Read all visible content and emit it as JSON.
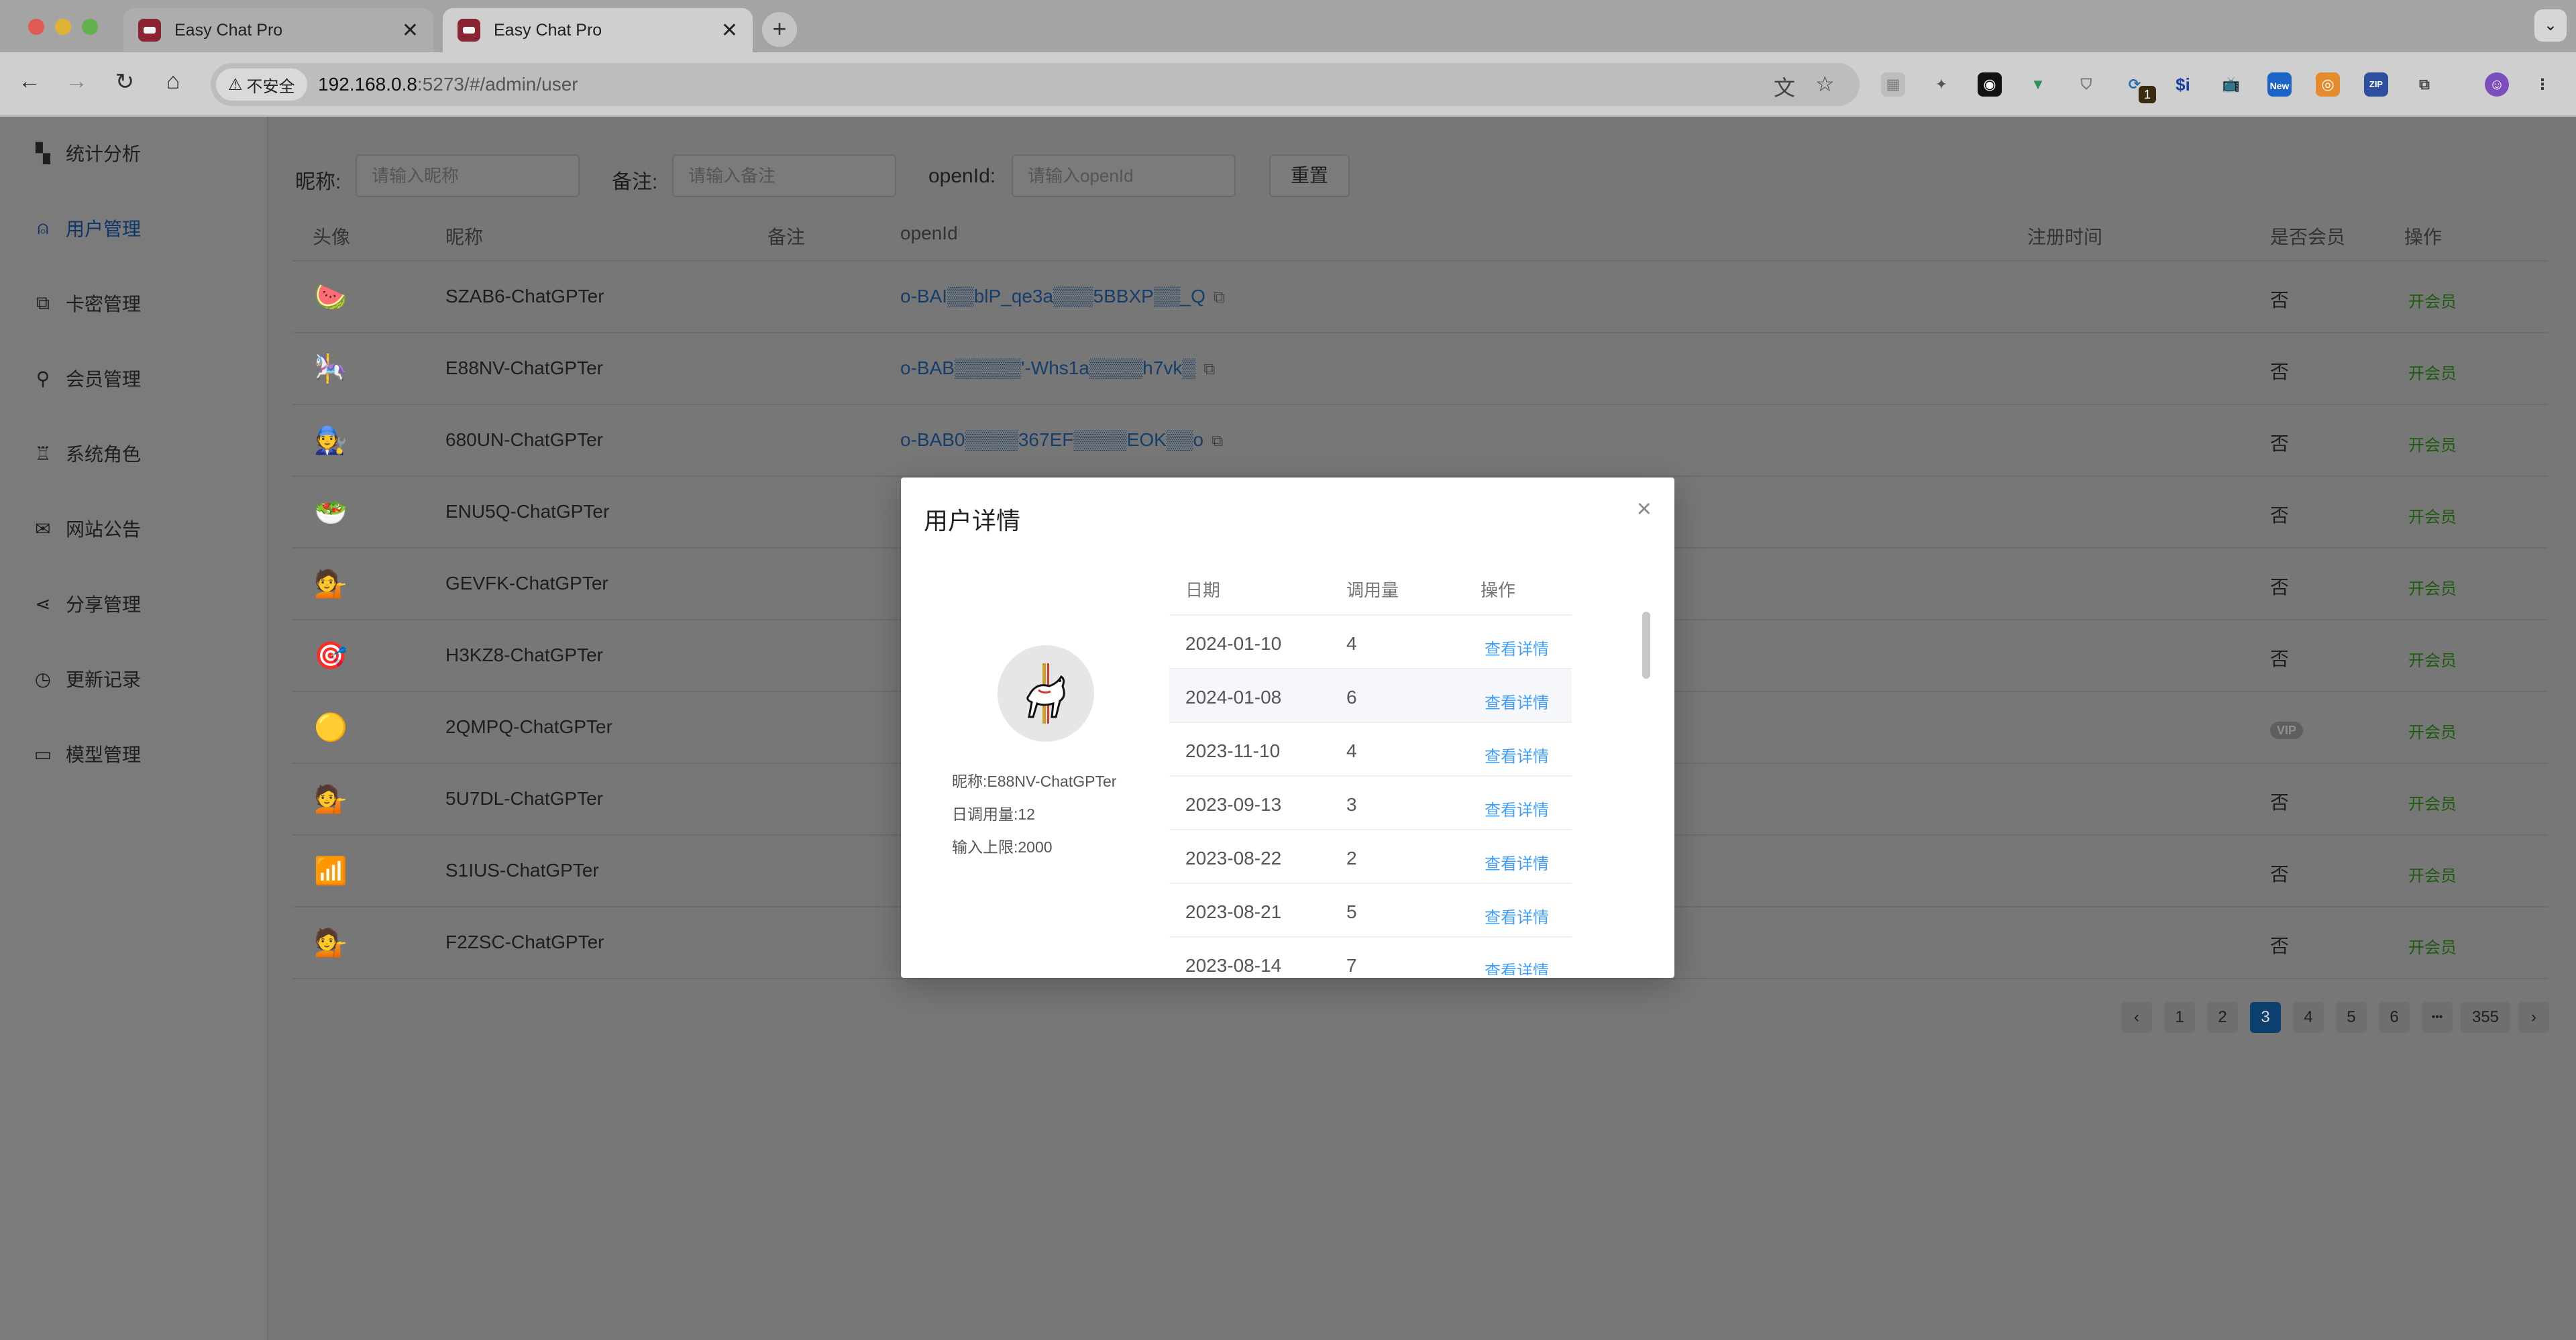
{
  "browser": {
    "tabs": [
      {
        "title": "Easy Chat Pro",
        "active": false
      },
      {
        "title": "Easy Chat Pro",
        "active": true
      }
    ],
    "security_label": "不安全",
    "url_host": "192.168.0.8",
    "url_rest": ":5273/#/admin/user",
    "new_badge": "New",
    "ext_counter": "1",
    "ext_dollar": "$i",
    "ext_zip": "ZIP"
  },
  "sidebar": {
    "items": [
      {
        "label": "统计分析",
        "icon": "dashboard-icon",
        "active": false
      },
      {
        "label": "用户管理",
        "icon": "user-icon",
        "active": true
      },
      {
        "label": "卡密管理",
        "icon": "card-icon",
        "active": false
      },
      {
        "label": "会员管理",
        "icon": "key-icon",
        "active": false
      },
      {
        "label": "系统角色",
        "icon": "role-icon",
        "active": false
      },
      {
        "label": "网站公告",
        "icon": "mail-icon",
        "active": false
      },
      {
        "label": "分享管理",
        "icon": "share-icon",
        "active": false
      },
      {
        "label": "更新记录",
        "icon": "clock-icon",
        "active": false
      },
      {
        "label": "模型管理",
        "icon": "monitor-icon",
        "active": false
      }
    ]
  },
  "filters": {
    "nickname_label": "昵称:",
    "nickname_placeholder": "请输入昵称",
    "remark_label": "备注:",
    "remark_placeholder": "请输入备注",
    "openid_label": "openId:",
    "openid_placeholder": "请输入openId",
    "reset_label": "重置"
  },
  "table": {
    "headers": {
      "avatar": "头像",
      "nickname": "昵称",
      "remark": "备注",
      "openid": "openId",
      "registered": "注册时间",
      "is_member": "是否会员",
      "action": "操作"
    },
    "rows": [
      {
        "avatar": "🍉",
        "nickname": "SZAB6-ChatGPTer",
        "openid": "o-BAI▒▒blP_qe3a▒▒▒5BBXP▒▒_Q",
        "member": "否",
        "vip": false,
        "action": "开会员"
      },
      {
        "avatar": "🎠",
        "nickname": "E88NV-ChatGPTer",
        "openid": "o-BAB▒▒▒▒▒'-Whs1a▒▒▒▒h7vk▒",
        "member": "否",
        "vip": false,
        "action": "开会员"
      },
      {
        "avatar": "🧑‍🔧",
        "nickname": "680UN-ChatGPTer",
        "openid": "o-BAB0▒▒▒▒367EF▒▒▒▒EOK▒▒o",
        "member": "否",
        "vip": false,
        "action": "开会员"
      },
      {
        "avatar": "🥗",
        "nickname": "ENU5Q-ChatGPTer",
        "openid": "",
        "member": "否",
        "vip": false,
        "action": "开会员"
      },
      {
        "avatar": "💁",
        "nickname": "GEVFK-ChatGPTer",
        "openid": "",
        "member": "否",
        "vip": false,
        "action": "开会员"
      },
      {
        "avatar": "🎯",
        "nickname": "H3KZ8-ChatGPTer",
        "openid": "",
        "member": "否",
        "vip": false,
        "action": "开会员"
      },
      {
        "avatar": "🟡",
        "nickname": "2QMPQ-ChatGPTer",
        "openid": "",
        "member": "VIP",
        "vip": true,
        "action": "开会员"
      },
      {
        "avatar": "💁",
        "nickname": "5U7DL-ChatGPTer",
        "openid": "",
        "member": "否",
        "vip": false,
        "action": "开会员"
      },
      {
        "avatar": "📶",
        "nickname": "S1IUS-ChatGPTer",
        "openid": "",
        "member": "否",
        "vip": false,
        "action": "开会员"
      },
      {
        "avatar": "💁",
        "nickname": "F2ZSC-ChatGPTer",
        "openid": "",
        "member": "否",
        "vip": false,
        "action": "开会员"
      }
    ]
  },
  "pagination": {
    "prev": "‹",
    "pages": [
      "1",
      "2",
      "3",
      "4",
      "5",
      "6"
    ],
    "ellipsis": "•••",
    "last": "355",
    "next": "›",
    "current": "3"
  },
  "modal": {
    "title": "用户详情",
    "close": "×",
    "avatar": "🎠",
    "nickname_label": "昵称:",
    "nickname": "E88NV-ChatGPTer",
    "daily_usage_label": "日调用量:",
    "daily_usage": "12",
    "input_limit_label": "输入上限:",
    "input_limit": "2000",
    "columns": {
      "date": "日期",
      "calls": "调用量",
      "action": "操作"
    },
    "rows": [
      {
        "date": "2024-01-10",
        "calls": "4",
        "action": "查看详情"
      },
      {
        "date": "2024-01-08",
        "calls": "6",
        "action": "查看详情"
      },
      {
        "date": "2023-11-10",
        "calls": "4",
        "action": "查看详情"
      },
      {
        "date": "2023-09-13",
        "calls": "3",
        "action": "查看详情"
      },
      {
        "date": "2023-08-22",
        "calls": "2",
        "action": "查看详情"
      },
      {
        "date": "2023-08-21",
        "calls": "5",
        "action": "查看详情"
      },
      {
        "date": "2023-08-14",
        "calls": "7",
        "action": "查看详情"
      }
    ]
  }
}
